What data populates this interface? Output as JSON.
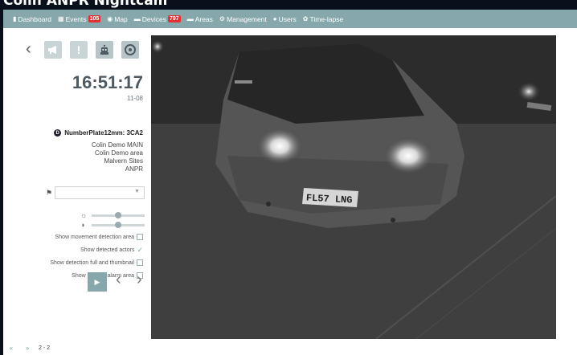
{
  "page": {
    "title": "Colin ANPR Nightcam"
  },
  "nav": {
    "items": [
      {
        "label": "Dashboard",
        "icon": "bar-chart-icon"
      },
      {
        "label": "Events",
        "icon": "grid-icon",
        "badge": "105"
      },
      {
        "label": "Map",
        "icon": "map-pin-icon"
      },
      {
        "label": "Devices",
        "icon": "folder-icon",
        "badge": "797"
      },
      {
        "label": "Areas",
        "icon": "folder-icon"
      },
      {
        "label": "Management",
        "icon": "gear-icon"
      },
      {
        "label": "Users",
        "icon": "user-icon"
      },
      {
        "label": "Time-lapse",
        "icon": "time-lapse-icon"
      }
    ]
  },
  "event": {
    "time": "16:51:17",
    "date": "11-08",
    "device_initial": "D",
    "device_name": "NumberPlate12mm: 3CA2",
    "info_lines": [
      "Colin Demo MAIN",
      "Colin Demo area",
      "Malvern Sites",
      "ANPR"
    ]
  },
  "tag_select": {
    "value": ""
  },
  "sliders": {
    "brightness": 0.5,
    "contrast": 0.5
  },
  "options": [
    {
      "label": "Show movement detection area",
      "checked": false
    },
    {
      "label": "Show detected actors",
      "checked": true
    },
    {
      "label": "Show detection full and thumbnail",
      "checked": false
    },
    {
      "label": "Show defined alarm area",
      "checked": false
    }
  ],
  "camera": {
    "plate": "FL57 LNG"
  },
  "pager": {
    "first": "«",
    "prev": "»",
    "count": "2 - 2"
  },
  "colors": {
    "accent": "#86a8ad",
    "badge": "#e5302f",
    "frame": "#0a0f1c"
  }
}
